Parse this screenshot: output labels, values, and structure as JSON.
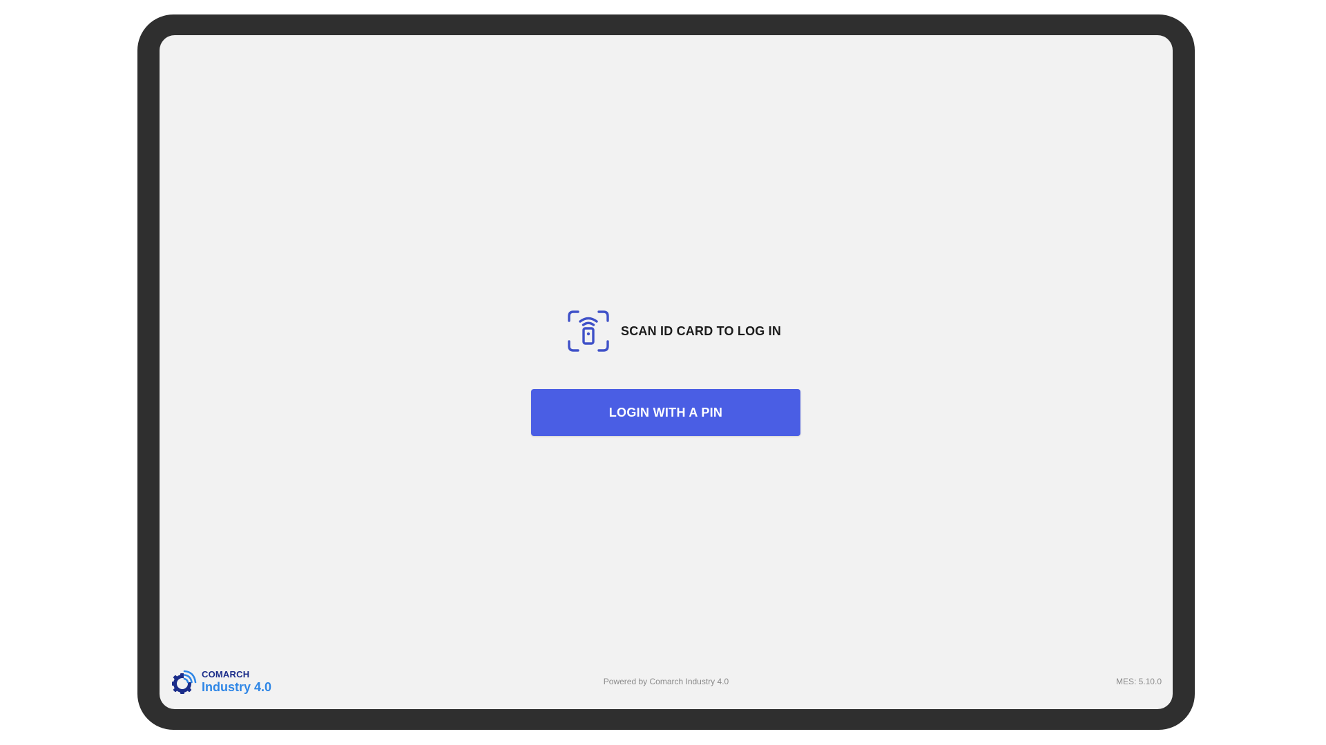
{
  "login": {
    "scan_text": "SCAN ID CARD TO LOG IN",
    "scan_icon": "nfc-card-scan-icon",
    "pin_button_label": "LOGIN WITH A PIN"
  },
  "footer": {
    "logo_brand": "COMARCH",
    "logo_product": "Industry 4.0",
    "powered_by": "Powered by Comarch Industry 4.0",
    "version": "MES: 5.10.0"
  },
  "colors": {
    "accent": "#4a5ee4",
    "icon": "#3f51c8",
    "bezel": "#2f2f2f",
    "screen_bg": "#f2f2f2",
    "logo_dark": "#1b2d8a",
    "logo_light": "#2e86e6"
  }
}
